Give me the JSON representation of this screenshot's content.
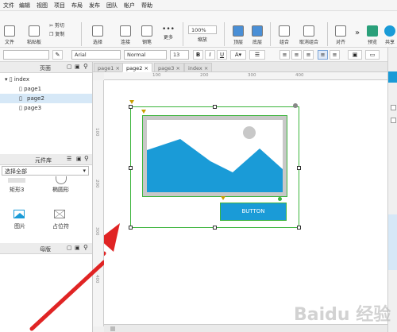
{
  "menu": [
    "文件",
    "编辑",
    "视图",
    "项目",
    "布局",
    "发布",
    "团队",
    "帐户",
    "帮助"
  ],
  "toolbar": {
    "items": [
      "文件",
      "粘贴板",
      "剪切",
      "复制",
      "选择",
      "连接",
      "钢笔",
      "更多",
      "缩放",
      "顶层",
      "底层",
      "组合",
      "取消组合",
      "对齐",
      "预览",
      "共享"
    ],
    "zoom": "100%"
  },
  "format": {
    "font": "Arial",
    "style": "Normal",
    "size": "13"
  },
  "pages_panel": {
    "title": "页面",
    "root": "index",
    "pages": [
      "page1",
      "page2",
      "page3"
    ],
    "selected": "page2"
  },
  "library_panel": {
    "title": "元件库",
    "select": "选择全部",
    "items": [
      "矩形3",
      "椭圆形",
      "图片",
      "占位符"
    ]
  },
  "masters_panel": {
    "title": "母版"
  },
  "tabs": [
    "page1",
    "page2",
    "page3",
    "index"
  ],
  "active_tab": "page2",
  "ruler_h": [
    "100",
    "200",
    "300",
    "400"
  ],
  "ruler_v": [
    "100",
    "200",
    "300",
    "400"
  ],
  "canvas": {
    "button_label": "BUTTON"
  },
  "watermark": "Baidu 经验",
  "colors": {
    "accent": "#1a9bd7",
    "selection": "#3cb43c",
    "arrow": "#e02424"
  }
}
